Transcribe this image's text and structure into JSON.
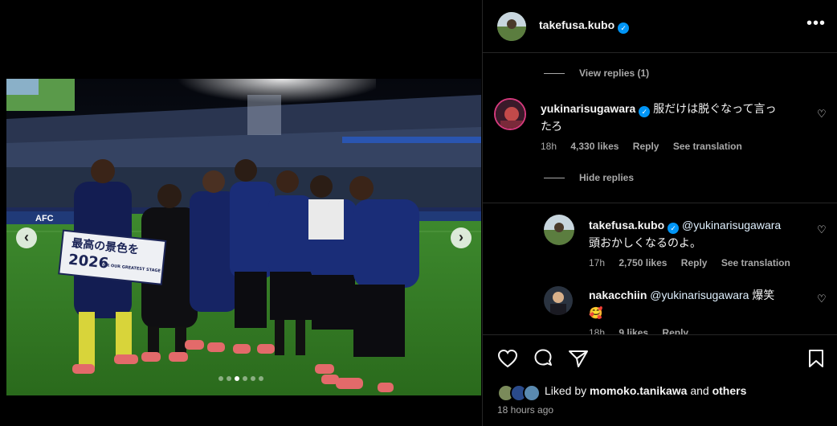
{
  "post": {
    "author": "takefusa.kubo",
    "banner_lines": [
      "最高の景色を",
      "2026",
      "FOR OUR GREATEST STAGE"
    ],
    "board_text": "AFC",
    "carousel": {
      "total": 6,
      "active_index": 2
    }
  },
  "comments": {
    "view_replies_label": "View replies (1)",
    "hide_replies_label": "Hide replies",
    "items": [
      {
        "user": "yukinarisugawara",
        "verified": true,
        "text_line1": "服だけは脱ぐなって言っ",
        "text_line2": "たろ",
        "time": "18h",
        "likes": "4,330 likes",
        "reply": "Reply",
        "translate": "See translation"
      },
      {
        "user": "takefusa.kubo",
        "verified": true,
        "mention": "@yukinarisugawara",
        "text": "頭おかしくなるのよ。",
        "time": "17h",
        "likes": "2,750 likes",
        "reply": "Reply",
        "translate": "See translation"
      },
      {
        "user": "nakacchiin",
        "mention": "@yukinarisugawara",
        "text": "爆笑",
        "emoji": "🥰",
        "time": "18h",
        "likes": "9 likes",
        "reply": "Reply"
      }
    ]
  },
  "actions": {
    "liked_prefix": "Liked by",
    "liked_user": "momoko.tanikawa",
    "liked_and": "and",
    "liked_others": "others",
    "timestamp": "18 hours ago"
  },
  "icons": {
    "more": "more-options-icon",
    "heart": "heart-icon",
    "comment": "comment-icon",
    "share": "share-icon",
    "save": "bookmark-icon",
    "verified": "verified-badge-icon",
    "prev": "chevron-left-icon",
    "next": "chevron-right-icon"
  },
  "colors": {
    "background": "#000000",
    "text": "#f5f5f5",
    "muted": "#a8a8a8",
    "verified": "#0095f6",
    "divider": "#262626"
  }
}
